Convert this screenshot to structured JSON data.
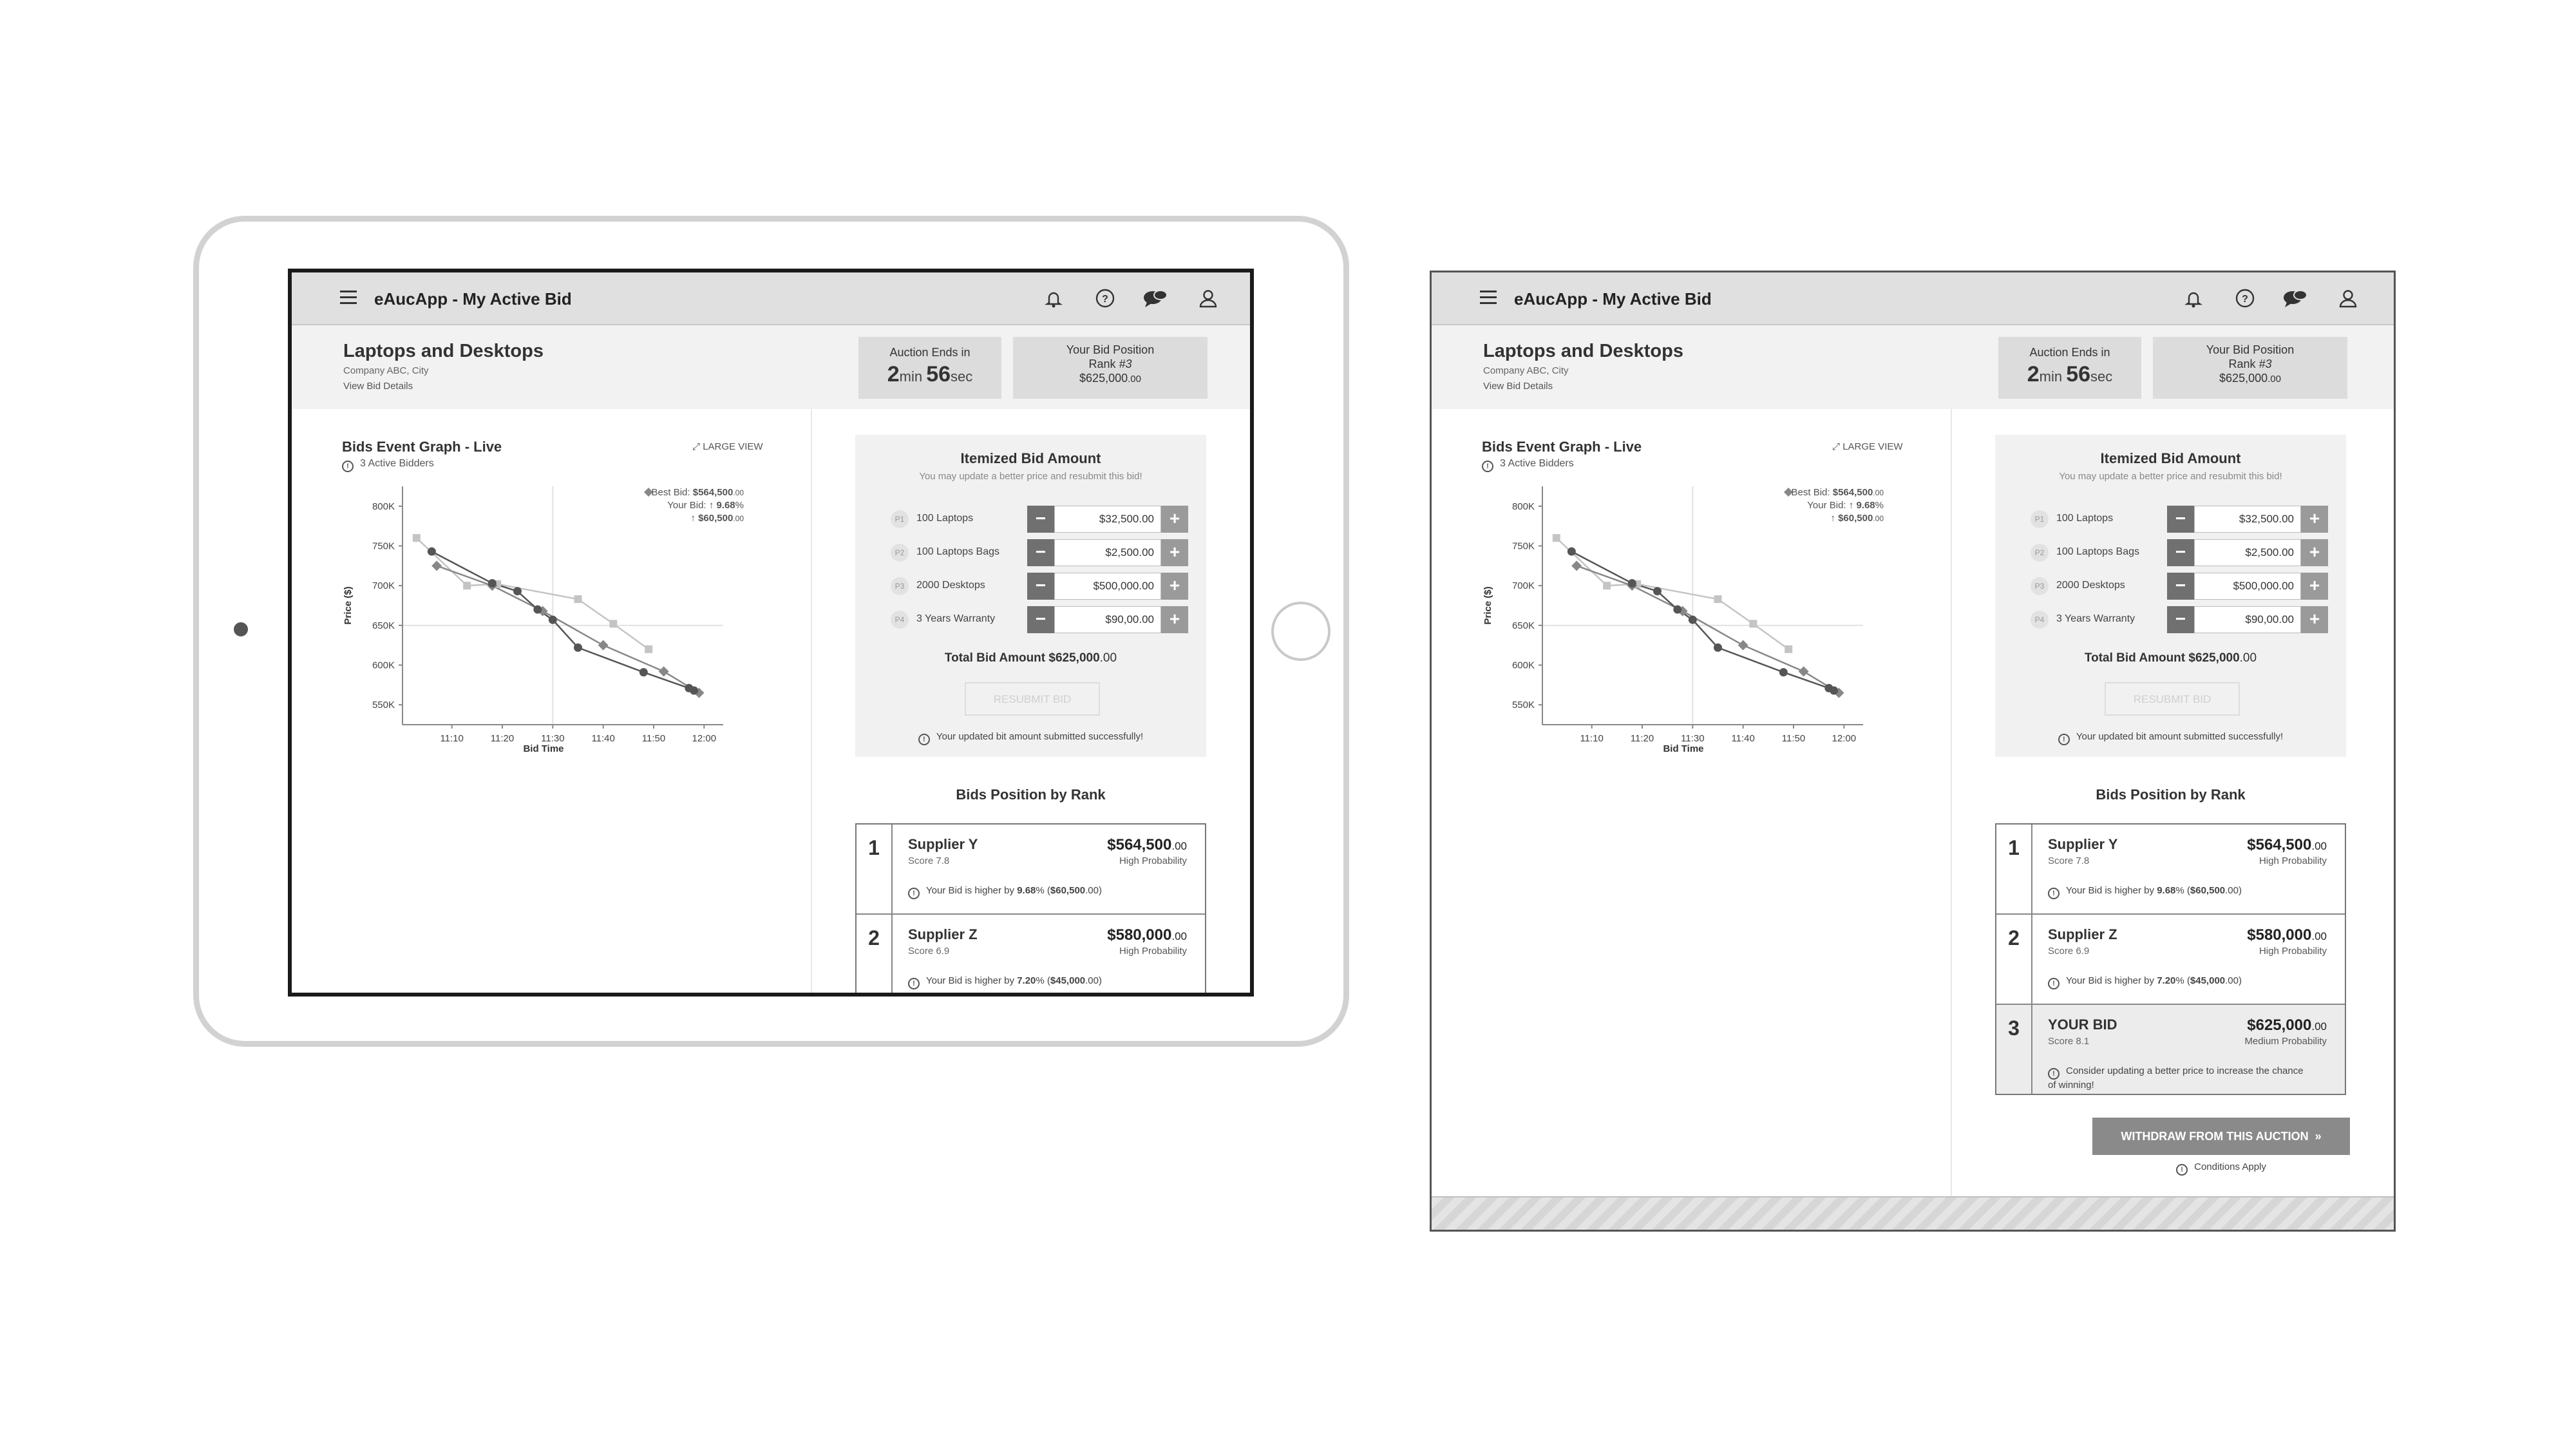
{
  "app_title": "eAucApp - My Active Bid",
  "project": {
    "title": "Laptops and Desktops",
    "company": "Company ABC, City",
    "view_details": "View Bid Details"
  },
  "auction": {
    "label": "Auction Ends in",
    "minutes": "2",
    "min_unit": "min",
    "seconds": "56",
    "sec_unit": "sec"
  },
  "position": {
    "label": "Your Bid Position",
    "rank_label": "Rank ",
    "rank": "#3",
    "amount_main": "$625,000",
    "amount_cents": ".00"
  },
  "graph": {
    "title": "Bids Event Graph - Live",
    "bidders": "3 Active Bidders",
    "large_view": "LARGE VIEW"
  },
  "chart_data": {
    "type": "line",
    "ylabel": "Price ($)",
    "xlabel": "Bid Time",
    "x_ticks": [
      "11:10",
      "11:20",
      "11:30",
      "11:40",
      "11:50",
      "12:00"
    ],
    "y_ticks": [
      "800K",
      "750K",
      "700K",
      "650K",
      "600K",
      "550K"
    ],
    "ylim": [
      525000,
      825000
    ],
    "xlim_minutes": [
      0,
      60
    ],
    "legend": {
      "best_label": "Best Bid: ",
      "best_value": "$564,500",
      "best_cents": ".00",
      "yours_label": "Your Bid: ",
      "yours_pct": "↑ 9.68",
      "pct_sign": "%",
      "yours_amt": "↑ $60,500",
      "yours_cents": ".00"
    },
    "series": [
      {
        "marker": "square",
        "color": "#c4c4c4",
        "points": [
          [
            1,
            760000
          ],
          [
            11,
            700000
          ],
          [
            17,
            702000
          ],
          [
            33,
            683000
          ],
          [
            40,
            652000
          ],
          [
            47,
            620000
          ]
        ]
      },
      {
        "marker": "diamond",
        "color": "#888888",
        "points": [
          [
            5,
            725000
          ],
          [
            16,
            700000
          ],
          [
            26,
            668000
          ],
          [
            38,
            625000
          ],
          [
            50,
            592000
          ],
          [
            57,
            565000
          ]
        ]
      },
      {
        "marker": "circle",
        "color": "#555555",
        "points": [
          [
            4,
            743000
          ],
          [
            16,
            703000
          ],
          [
            21,
            693000
          ],
          [
            25,
            670000
          ],
          [
            28,
            657000
          ],
          [
            33,
            622000
          ],
          [
            46,
            591000
          ],
          [
            55,
            571000
          ],
          [
            56,
            568000
          ]
        ]
      }
    ]
  },
  "itemized": {
    "title": "Itemized Bid Amount",
    "subtitle": "You may update a better price and resubmit this bid!",
    "items": [
      {
        "badge": "P1",
        "name": "100 Laptops",
        "value": "$32,500.00"
      },
      {
        "badge": "P2",
        "name": "100 Laptops Bags",
        "value": "$2,500.00"
      },
      {
        "badge": "P3",
        "name": "2000 Desktops",
        "value": "$500,000.00"
      },
      {
        "badge": "P4",
        "name": "3 Years Warranty",
        "value": "$90,00.00"
      }
    ],
    "total_label": "Total Bid Amount ",
    "total_value": "$625,000",
    "total_cents": ".00",
    "resubmit": "RESUBMIT BID",
    "success": "Your updated bit amount submitted successfully!"
  },
  "ranking": {
    "title": "Bids Position by Rank",
    "rows": [
      {
        "rank": "1",
        "name": "Supplier Y",
        "score": "Score 7.8",
        "amount": "$564,500",
        "cents": ".00",
        "probability": "High Probability",
        "note_pre": "Your Bid is higher by ",
        "note_pct": "9.68",
        "note_mid": "% (",
        "note_amt": "$60,500",
        "note_post": ".00)"
      },
      {
        "rank": "2",
        "name": "Supplier Z",
        "score": "Score 6.9",
        "amount": "$580,000",
        "cents": ".00",
        "probability": "High Probability",
        "note_pre": "Your Bid is higher by ",
        "note_pct": "7.20",
        "note_mid": "% (",
        "note_amt": "$45,000",
        "note_post": ".00)"
      },
      {
        "rank": "3",
        "name": "YOUR BID",
        "score": "Score 8.1",
        "amount": "$625,000",
        "cents": ".00",
        "probability": "Medium Probability",
        "note": "Consider updating a better price to increase the chance of winning!"
      }
    ]
  },
  "withdraw": {
    "label": "WITHDRAW FROM THIS AUCTION",
    "arrow": "»",
    "conditions": "Conditions Apply"
  }
}
